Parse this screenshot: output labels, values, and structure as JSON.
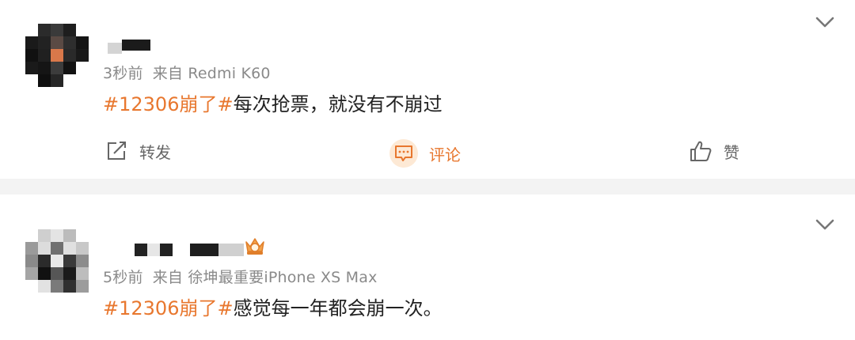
{
  "posts": [
    {
      "time": "3秒前",
      "source": "来自 Redmi K60",
      "hashtag": "#12306崩了#",
      "body": "每次抢票，就没有不崩过",
      "actions": {
        "repost": "转发",
        "comment": "评论",
        "like": "赞"
      }
    },
    {
      "time": "5秒前",
      "source": "来自 徐坤最重要iPhone XS Max",
      "hashtag": "#12306崩了#",
      "body": "感觉每一年都会崩一次。"
    }
  ],
  "colors": {
    "accent": "#e8772e",
    "meta": "#8a8a8a",
    "separator": "#f3f3f3"
  },
  "icons": [
    "chevron-down-icon",
    "repost-icon",
    "comment-icon",
    "like-icon",
    "crown-badge-icon"
  ]
}
